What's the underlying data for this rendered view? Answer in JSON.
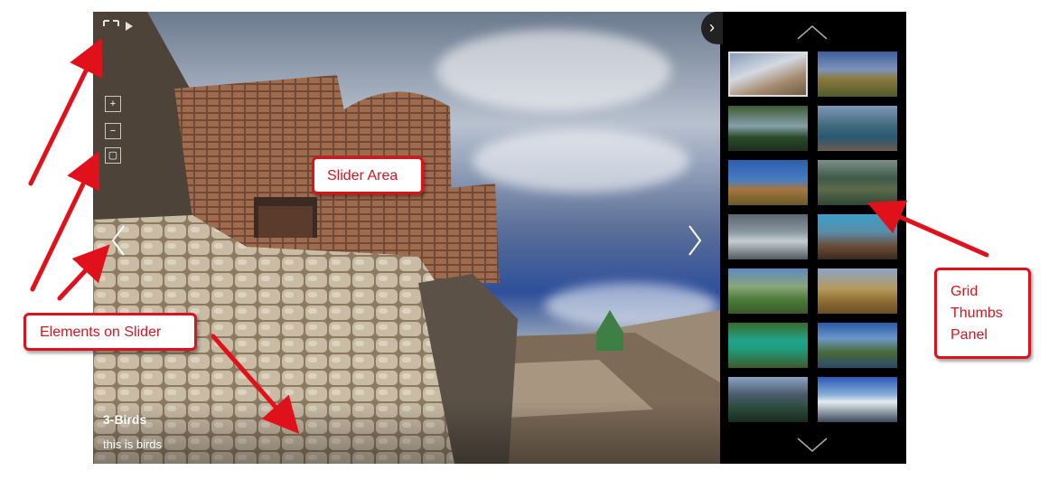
{
  "slider": {
    "caption_title": "3-Birds",
    "caption_desc": "this is birds"
  },
  "callouts": {
    "slider_area": "Slider Area",
    "elements_on_slider": "Elements on Slider",
    "grid_thumbs_panel": "Grid\nThumbs\nPanel"
  },
  "colors": {
    "annotation_red": "#e0111b",
    "panel_bg": "#000000"
  },
  "icons": [
    "fullscreen-icon",
    "zoom-in-icon",
    "zoom-out-icon",
    "prev-arrow-icon",
    "next-arrow-icon",
    "toggle-panel-icon",
    "thumbs-up-arrow-icon",
    "thumbs-down-arrow-icon"
  ]
}
